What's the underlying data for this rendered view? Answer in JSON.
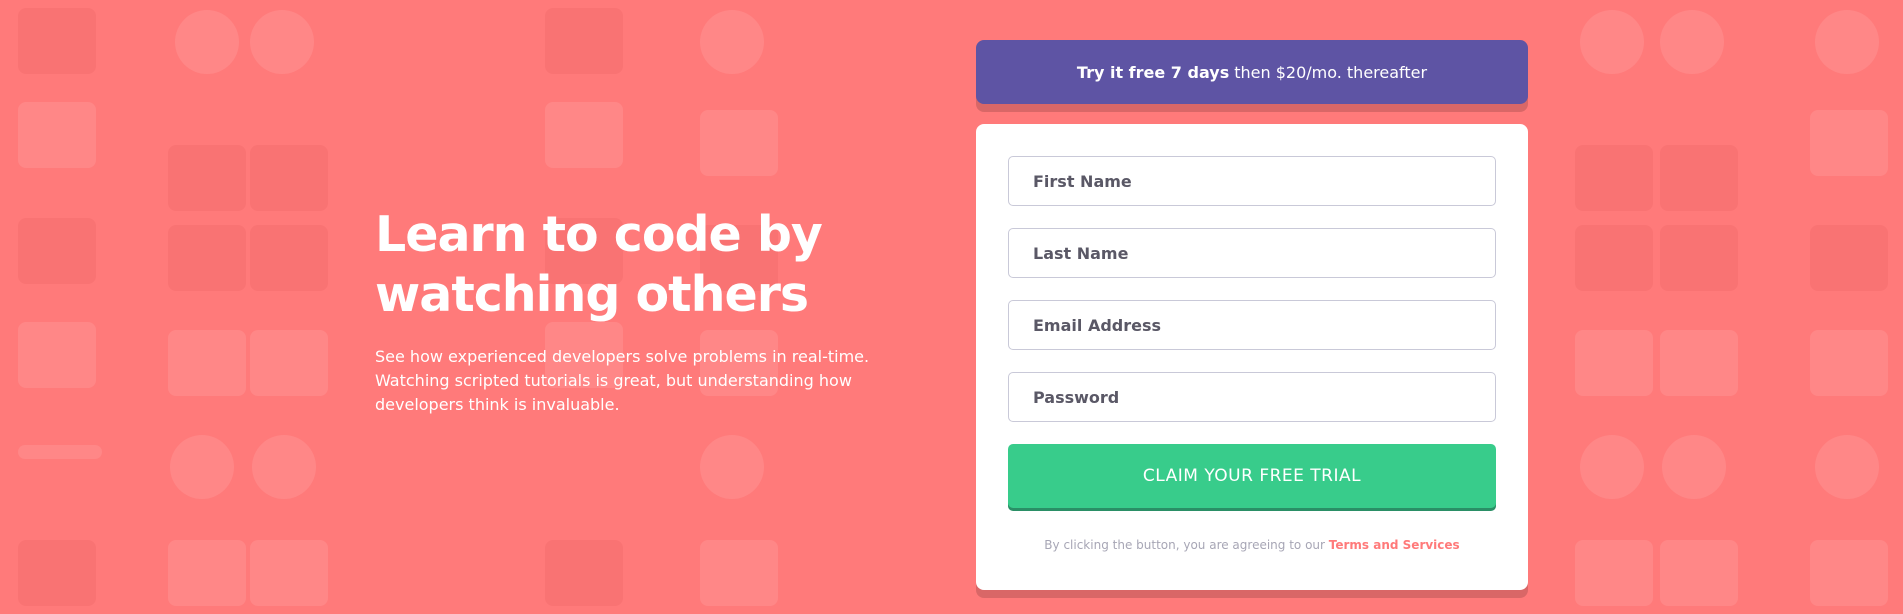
{
  "hero": {
    "title": "Learn to code by watching others",
    "description": "See how experienced developers solve problems in real-time. Watching scripted tutorials is great, but understanding how developers think is invaluable."
  },
  "banner": {
    "bold": "Try it free 7 days",
    "rest": "then $20/mo. thereafter"
  },
  "form": {
    "first_name_placeholder": "First Name",
    "last_name_placeholder": "Last Name",
    "email_placeholder": "Email Address",
    "password_placeholder": "Password",
    "submit_label": "CLAIM YOUR FREE TRIAL",
    "terms_text": "By clicking the button, you are agreeing to our",
    "terms_link": "Terms and Services"
  },
  "colors": {
    "background": "#ff7a7a",
    "banner": "#5e54a4",
    "cta": "#38cc8b",
    "link": "#ff7a7a"
  }
}
